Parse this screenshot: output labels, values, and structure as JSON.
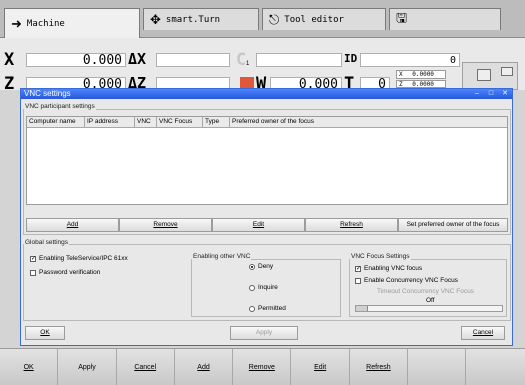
{
  "tabs": [
    {
      "label": "Machine",
      "icon": "arrow-right-icon"
    },
    {
      "label": "smart.Turn",
      "icon": "move-arrows-icon"
    },
    {
      "label": "Tool editor",
      "icon": "tool-editor-icon"
    },
    {
      "label": "",
      "icon": "save-disk-icon"
    }
  ],
  "readout": {
    "x_label": "X",
    "x_value": "0.000",
    "dx_label": "ΔX",
    "c_label": "C",
    "c_sub": "1",
    "id_label": "ID",
    "id_value": "0",
    "z_label": "Z",
    "z_value": "0.000",
    "dz_label": "ΔZ",
    "w_label": "W",
    "w_value": "0.000",
    "t_label": "T",
    "t_value": "0",
    "x_small_label": "X",
    "x_small_value": "0.0000",
    "z_small_label": "Z",
    "z_small_value": "0.0000"
  },
  "dialog": {
    "title": "VNC settings",
    "participants_label": "VNC participant settings",
    "columns": [
      "Computer name",
      "IP address",
      "VNC",
      "VNC Focus",
      "Type",
      "Preferred owner of the focus"
    ],
    "rows": [],
    "table_buttons": [
      "Add",
      "Remove",
      "Edit",
      "Refresh",
      "Set preferred owner of the focus"
    ],
    "global_label": "Global settings",
    "enabling_teleservice": "Enabling TeleService/IPC 61xx",
    "password_verification": "Password verification",
    "enabling_other_label": "Enabling other VNC",
    "deny": "Deny",
    "inquire": "Inquire",
    "permitted": "Permitted",
    "focus_label": "VNC Focus Settings",
    "enabling_focus": "Enabling VNC focus",
    "enable_concurrency": "Enable Concurrency VNC Focus",
    "timeout_label": "Timeout Concurrency VNC Focus",
    "timeout_value": "Off",
    "ok": "OK",
    "apply": "Apply",
    "cancel": "Cancel"
  },
  "softkeys": [
    "OK",
    "Apply",
    "Cancel",
    "Add",
    "Remove",
    "Edit",
    "Refresh",
    "",
    ""
  ]
}
